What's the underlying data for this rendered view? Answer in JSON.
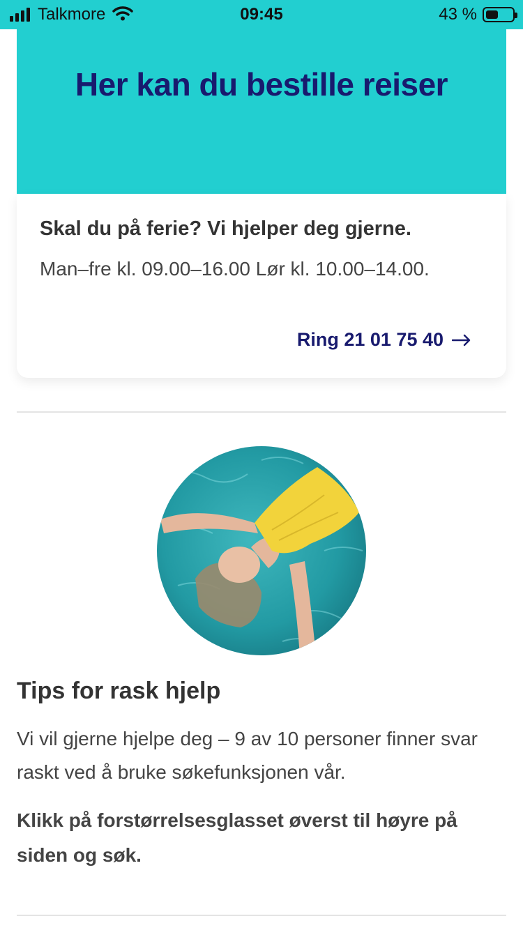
{
  "status_bar": {
    "carrier": "Talkmore",
    "time": "09:45",
    "battery": "43 %"
  },
  "hero": {
    "title": "Her kan du bestille reiser",
    "background_color": "#22cfd0",
    "title_color": "#181a6e"
  },
  "card": {
    "heading": "Skal du på ferie? Vi hjelper deg gjerne.",
    "hours": "Man–fre kl. 09.00–16.00 Lør kl. 10.00–14.00.",
    "call_label": "Ring 21 01 75 40",
    "call_icon": "arrow-right-icon"
  },
  "image": {
    "icon": "photo-woman-floating-in-water"
  },
  "tips": {
    "title": "Tips for rask hjelp",
    "body": "Vi vil gjerne hjelpe deg – 9 av 10 personer finner svar raskt ved å bruke søkefunksjonen vår.",
    "cta": "Klikk på forstørrelsesglasset øverst til høyre på siden og søk."
  }
}
